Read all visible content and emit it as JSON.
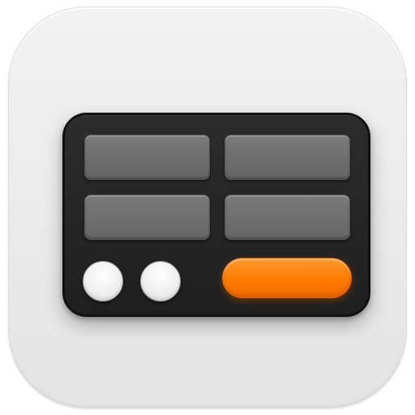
{
  "icon": {
    "name": "keypad-app-icon",
    "colors": {
      "background": "#ececec",
      "device_body": "#262626",
      "keys": "#6e6e6e",
      "dots": "#f2f2f2",
      "accent": "#ff7f0a"
    },
    "key_count": 4,
    "dot_count": 2,
    "accent_shape": "pill"
  }
}
